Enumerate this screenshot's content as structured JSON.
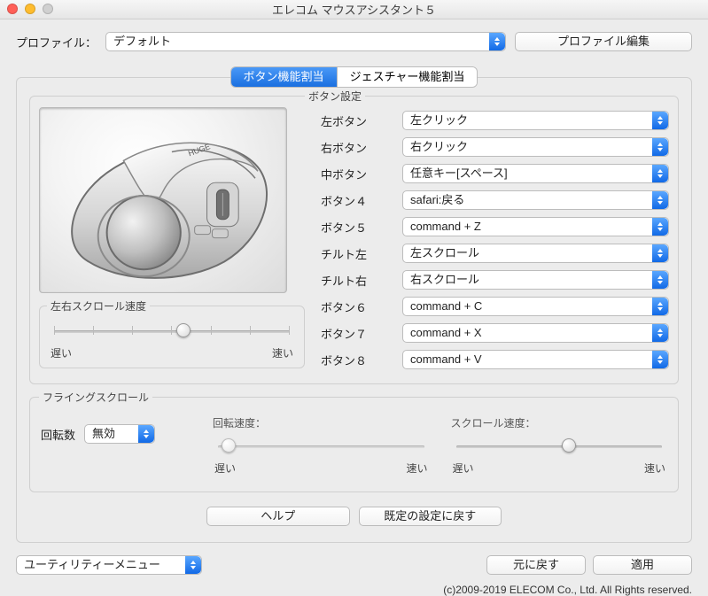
{
  "window": {
    "title": "エレコム マウスアシスタント５"
  },
  "profile": {
    "label": "プロファイル：",
    "selected": "デフォルト",
    "edit_button": "プロファイル編集"
  },
  "tabs": {
    "button_assign": "ボタン機能割当",
    "gesture_assign": "ジェスチャー機能割当",
    "active": "button_assign"
  },
  "button_settings": {
    "legend": "ボタン設定",
    "rows": [
      {
        "label": "左ボタン",
        "value": "左クリック"
      },
      {
        "label": "右ボタン",
        "value": "右クリック"
      },
      {
        "label": "中ボタン",
        "value": "任意キー[スペース]"
      },
      {
        "label": "ボタン４",
        "value": "safari:戻る"
      },
      {
        "label": "ボタン５",
        "value": "command + Z"
      },
      {
        "label": "チルト左",
        "value": "左スクロール"
      },
      {
        "label": "チルト右",
        "value": "右スクロール"
      },
      {
        "label": "ボタン６",
        "value": "command + C"
      },
      {
        "label": "ボタン７",
        "value": "command + X"
      },
      {
        "label": "ボタン８",
        "value": "command + V"
      }
    ]
  },
  "lr_scroll": {
    "legend": "左右スクロール速度",
    "position_pct": 55,
    "ticks": 7,
    "slow": "遅い",
    "fast": "速い"
  },
  "flying": {
    "legend": "フライングスクロール",
    "rotation_label": "回転数",
    "rotation_value": "無効",
    "rotation_speed_label": "回転速度：",
    "rotation_speed_pct": 5,
    "scroll_speed_label": "スクロール速度：",
    "scroll_speed_pct": 55,
    "slow": "遅い",
    "fast": "速い"
  },
  "bottom_buttons": {
    "help": "ヘルプ",
    "restore_defaults": "既定の設定に戻す"
  },
  "footer": {
    "utility_menu": "ユーティリティーメニュー",
    "revert": "元に戻す",
    "apply": "適用",
    "copyright": "(c)2009-2019 ELECOM Co., Ltd. All Rights reserved."
  }
}
